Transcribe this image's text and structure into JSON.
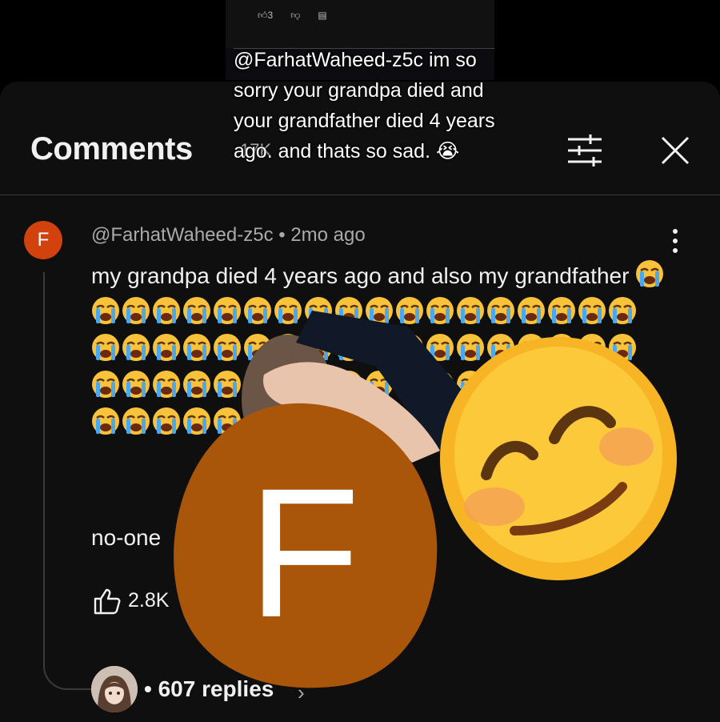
{
  "fragment": {
    "likes": "3",
    "actions": [
      "like-icon",
      "dislike-icon",
      "reply-icon"
    ]
  },
  "overlay_comment": {
    "text": "@FarhatWaheed-z5c im so sorry your grandpa died and your grandfather died 4 years ago. and thats so sad. 😭"
  },
  "header": {
    "title": "Comments",
    "count": "17K",
    "icons": [
      "filter-icon",
      "close-icon"
    ]
  },
  "comment": {
    "avatar_letter": "F",
    "avatar_color": "#d2420e",
    "author": "@FarhatWaheed-z5c",
    "separator": "•",
    "time": "2mo ago",
    "text": "my grandpa died 4 years ago and also my grandfather",
    "emoji": "😭",
    "tail": "no-one",
    "likes": "2.8K",
    "replies": "• 607 replies"
  },
  "stickers": {
    "letter": "F",
    "letter_bg": "#a9550a",
    "smile_color": "#f7b525"
  }
}
